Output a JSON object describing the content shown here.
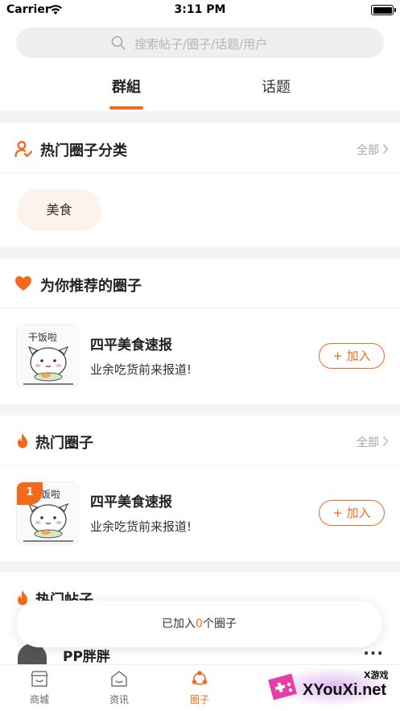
{
  "status_bar": {
    "carrier": "Carrier",
    "time": "3:11 PM"
  },
  "search": {
    "placeholder": "搜索帖子/圈子/话题/用户"
  },
  "tabs": [
    {
      "label": "群組",
      "active": true
    },
    {
      "label": "话题",
      "active": false
    }
  ],
  "hot_categories": {
    "title": "热门圈子分类",
    "more_label": "全部",
    "chips": [
      {
        "label": "美食"
      }
    ]
  },
  "recommended": {
    "title": "为你推荐的圈子",
    "groups": [
      {
        "name": "四平美食速报",
        "desc": "业余吃货前来报道!",
        "join_label": "+ 加入"
      }
    ]
  },
  "hot_groups": {
    "title": "热门圈子",
    "more_label": "全部",
    "groups": [
      {
        "rank": "1",
        "name": "四平美食速报",
        "desc": "业余吃货前来报道!",
        "join_label": "+ 加入"
      }
    ]
  },
  "hot_posts": {
    "title": "热门帖子",
    "first_author": "PP胖胖",
    "more_icon": "···"
  },
  "toast": {
    "prefix": "已加入",
    "count": "0",
    "suffix": "个圈子"
  },
  "tabbar": {
    "items": [
      {
        "label": "商城",
        "icon": "store-icon"
      },
      {
        "label": "资讯",
        "icon": "home-icon"
      },
      {
        "label": "圈子",
        "icon": "circle-icon",
        "active": true
      }
    ]
  },
  "watermark": {
    "brand": "XYouXi.net",
    "small": "X游戏"
  },
  "colors": {
    "accent": "#f46a1a",
    "chip_bg": "#fdf3ec",
    "page_bg": "#f4f4f4"
  }
}
